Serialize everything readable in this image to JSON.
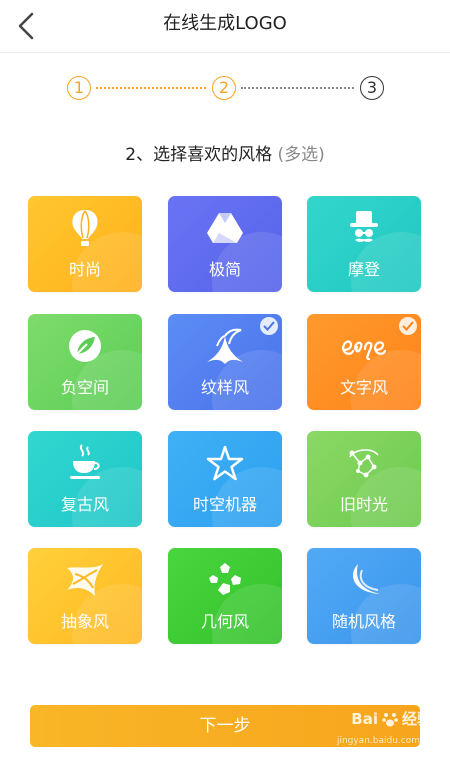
{
  "header": {
    "title": "在线生成LOGO"
  },
  "stepper": {
    "step1": "1",
    "step2": "2",
    "step3": "3"
  },
  "section": {
    "title": "2、选择喜欢的风格",
    "hint": "(多选)"
  },
  "styles": [
    {
      "label": "时尚",
      "icon": "hot-air-balloon-icon",
      "selected": false,
      "color_from": "#ffc72e",
      "color_to": "#ffb01c"
    },
    {
      "label": "极简",
      "icon": "drive-triangle-icon",
      "selected": false,
      "color_from": "#6a73f3",
      "color_to": "#5664ea"
    },
    {
      "label": "摩登",
      "icon": "hat-mustache-icon",
      "selected": false,
      "color_from": "#33d6cb",
      "color_to": "#20c8c2"
    },
    {
      "label": "负空间",
      "icon": "leaf-circle-icon",
      "selected": false,
      "color_from": "#7edc6a",
      "color_to": "#5ccd57"
    },
    {
      "label": "纹样风",
      "icon": "bird-icon",
      "selected": true,
      "color_from": "#5b8df5",
      "color_to": "#4b72ea"
    },
    {
      "label": "文字风",
      "icon": "script-lettering-icon",
      "selected": true,
      "color_from": "#ff9a2e",
      "color_to": "#ff8318"
    },
    {
      "label": "复古风",
      "icon": "coffee-cup-icon",
      "selected": false,
      "color_from": "#31d7cf",
      "color_to": "#1fc6c9"
    },
    {
      "label": "时空机器",
      "icon": "star-outline-icon",
      "selected": false,
      "color_from": "#3fb1f6",
      "color_to": "#2d9ff0"
    },
    {
      "label": "旧时光",
      "icon": "constellation-icon",
      "selected": false,
      "color_from": "#8bd866",
      "color_to": "#6dca4e"
    },
    {
      "label": "抽象风",
      "icon": "abstract-swirl-icon",
      "selected": false,
      "color_from": "#ffd03a",
      "color_to": "#ffb822"
    },
    {
      "label": "几何风",
      "icon": "pentagons-icon",
      "selected": false,
      "color_from": "#49d53e",
      "color_to": "#34c22c"
    },
    {
      "label": "随机风格",
      "icon": "swoosh-icon",
      "selected": false,
      "color_from": "#52aaf6",
      "color_to": "#3b95ec"
    }
  ],
  "next_button": {
    "label": "下一步"
  },
  "watermark": {
    "brand": "Bai",
    "brand_suffix": "经验",
    "url": "jingyan.baidu.com"
  }
}
